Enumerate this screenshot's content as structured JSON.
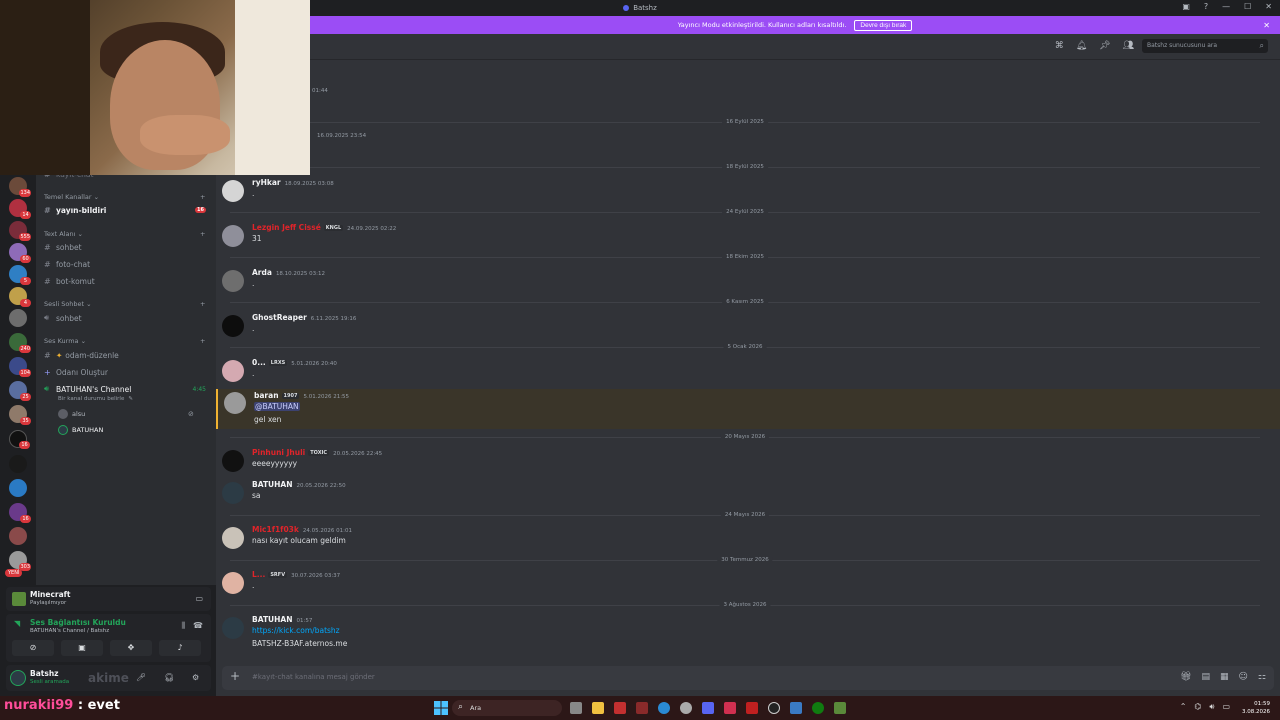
{
  "window": {
    "title": "Batshz"
  },
  "banner": {
    "text": "Yayıncı Modu etkinleştirildi. Kullanıcı adları kısaltıldı.",
    "button_label": "Devre dışı bırak",
    "bg": "#9b4df5"
  },
  "search": {
    "placeholder": "Batshz sunucusunu ara"
  },
  "servers": [
    {
      "badge": "134"
    },
    {
      "badge": "14"
    },
    {
      "badge": "555"
    },
    {
      "badge": "60"
    },
    {
      "badge": "5"
    },
    {
      "badge": "4"
    },
    {
      "badge": ""
    },
    {
      "badge": "240"
    },
    {
      "badge": "104"
    },
    {
      "badge": "25"
    },
    {
      "badge": "35"
    },
    {
      "badge": "16"
    },
    {
      "badge": ""
    },
    {
      "badge": ""
    },
    {
      "badge": "16"
    },
    {
      "badge": "303"
    }
  ],
  "new_label": "YENİ",
  "sidebar": {
    "partial_top": "kayıt-chat",
    "cat_temel": "Temel Kanallar",
    "ch_yayin": "yayın-bildiri",
    "ch_yayin_badge": "16",
    "cat_text": "Text Alanı",
    "ch_sohbet": "sohbet",
    "ch_foto": "foto-chat",
    "ch_bot": "bot-komut",
    "cat_sesli": "Sesli Sohbet",
    "ch_sesli_sohbet": "sohbet",
    "cat_ses": "Ses Kurma",
    "ch_oda": "odam-düzenle",
    "ch_olustur": "Odanı Oluştur",
    "voice_channel": "BATUHAN's Channel",
    "voice_time": "4:45",
    "voice_status": "Bir kanal durumu belirle",
    "users": [
      "alsu",
      "BATUHAN"
    ]
  },
  "activity": {
    "title": "Minecraft",
    "sub": "Paylaşılmıyor"
  },
  "voice_panel": {
    "title": "Ses Bağlantısı Kuruldu",
    "sub": "BATUHAN's Channel / Batshz"
  },
  "userbar": {
    "name": "Batshz",
    "status": "Sesli aramada"
  },
  "messages_top": [
    {
      "ts": "01:44"
    },
    {
      "ts": "16.09.2025 23:54"
    }
  ],
  "dividers": [
    "16 Eylül 2025",
    "18 Eylül 2025",
    "24 Eylül 2025",
    "18 Ekim 2025",
    "6 Kasım 2025",
    "5 Ocak 2026",
    "20 Mayıs 2026",
    "24 Mayıs 2026",
    "30 Temmuz 2026",
    "3 Ağustos 2026"
  ],
  "messages": [
    {
      "author": "ryHkar",
      "tag": "",
      "ts": "18.09.2025 03:08",
      "lines": [
        "."
      ],
      "color": "#f2f3f5"
    },
    {
      "author": "Lezgin Jeff Cissé",
      "tag": "KNGL",
      "ts": "24.09.2025 02:22",
      "lines": [
        "31"
      ],
      "color": "#e0242a"
    },
    {
      "author": "Arda",
      "tag": "",
      "ts": "18.10.2025 03:12",
      "lines": [
        "."
      ],
      "color": "#f2f3f5"
    },
    {
      "author": "GhostReaper",
      "tag": "",
      "ts": "6.11.2025 19:16",
      "lines": [
        "."
      ],
      "color": "#f2f3f5"
    },
    {
      "author": "0...",
      "tag": "LRXS",
      "ts": "5.01.2026 20:40",
      "lines": [
        "."
      ],
      "color": "#f2f3f5"
    },
    {
      "author": "baran",
      "tag": "1907",
      "ts": "5.01.2026 21:55",
      "mention": "@BATUHAN",
      "lines": [
        "gel xen"
      ],
      "color": "#f2f3f5"
    },
    {
      "author": "Pinhuni Jhuli",
      "tag": "TOXIC",
      "ts": "20.05.2026 22:45",
      "lines": [
        "eeeeyyyyyy"
      ],
      "color": "#e0242a"
    },
    {
      "author": "BATUHAN",
      "tag": "",
      "ts": "20.05.2026 22:50",
      "lines": [
        "sa"
      ],
      "color": "#f2f3f5"
    },
    {
      "author": "Mic1f1f03k",
      "tag": "",
      "ts": "24.05.2026 01:01",
      "lines": [
        "nası kayıt olucam geldim"
      ],
      "color": "#e0242a"
    },
    {
      "author": "L...",
      "tag": "SRFV",
      "ts": "30.07.2026 03:37",
      "lines": [
        "."
      ],
      "color": "#e0242a"
    },
    {
      "author": "BATUHAN",
      "tag": "",
      "ts": "01:57",
      "link": "https://kick.com/batshz",
      "lines": [
        "BATSHZ-B3AF.aternos.me"
      ],
      "color": "#f2f3f5"
    }
  ],
  "composer": {
    "placeholder": "#kayıt-chat kanalına mesaj gönder"
  },
  "taskbar": {
    "search": "Ara",
    "time": "01:59",
    "date": "3.08.2026"
  },
  "chat_overlay": {
    "name": "nurakii99",
    "text": ": evet"
  },
  "overlay_ghost": "akime"
}
